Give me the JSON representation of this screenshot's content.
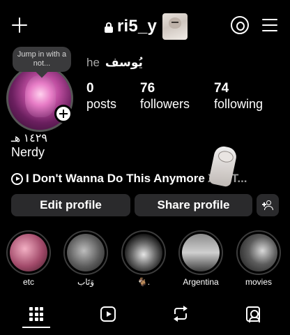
{
  "header": {
    "username": "ri5_y",
    "new_post_icon": "plus-icon",
    "lock_icon": "lock-icon",
    "threads_icon": "threads-icon",
    "menu_icon": "hamburger-menu-icon"
  },
  "profile": {
    "note_bubble": "Jump in with a not...",
    "pronouns": "he",
    "full_name": "يُوسف",
    "stats": [
      {
        "value": "0",
        "label": "posts"
      },
      {
        "value": "76",
        "label": "followers"
      },
      {
        "value": "74",
        "label": "following"
      }
    ],
    "bio_line1": "١٤٢٩ هـ",
    "bio_line2": "Nerdy",
    "music": {
      "icon": "play-circle-icon",
      "track": "I Don't Wanna Do This Anymore",
      "artist_tail": "XXXT..."
    }
  },
  "actions": {
    "edit_profile": "Edit profile",
    "share_profile": "Share profile",
    "discover_people_icon": "person-plus-icon"
  },
  "highlights": [
    {
      "label": "etc"
    },
    {
      "label": "وَتَاب"
    },
    {
      "label": "🐐."
    },
    {
      "label": "Argentina"
    },
    {
      "label": "movies"
    }
  ],
  "tabs": [
    {
      "icon": "grid-icon",
      "active": true
    },
    {
      "icon": "reels-icon",
      "active": false
    },
    {
      "icon": "repost-icon",
      "active": false
    },
    {
      "icon": "tagged-icon",
      "active": false
    }
  ]
}
